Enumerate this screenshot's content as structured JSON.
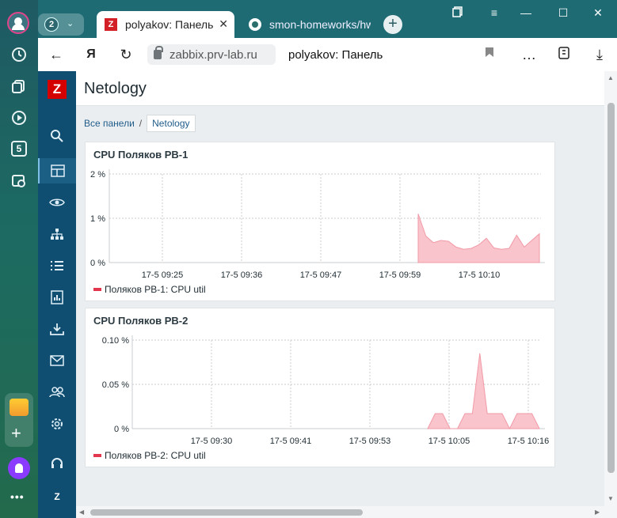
{
  "browser": {
    "tab_count": "2",
    "tabs": [
      {
        "title": "polyakov: Панель",
        "active": true
      },
      {
        "title": "smon-homeworks/hw",
        "active": false
      }
    ],
    "url": "zabbix.prv-lab.ru",
    "page_title": "polyakov: Панель"
  },
  "app": {
    "dashboard_title": "Netology",
    "breadcrumb": {
      "all": "Все панели",
      "separator": "/",
      "current": "Netology"
    }
  },
  "widgets": [
    {
      "title": "CPU Поляков РВ-1",
      "legend": "Поляков РВ-1: CPU util"
    },
    {
      "title": "CPU Поляков РВ-2",
      "legend": "Поляков РВ-2: CPU util"
    }
  ],
  "colors": {
    "series": "#e3374f",
    "fill": "#f9c4cb",
    "accent": "#d40000",
    "sidebar": "#0f4e70"
  },
  "chart_data": [
    {
      "type": "area",
      "title": "CPU Поляков РВ-1",
      "ylabel": "",
      "y_ticks": [
        "0 %",
        "1 %",
        "2 %"
      ],
      "ylim": [
        0,
        2
      ],
      "x_ticks": [
        "17-5 09:25",
        "17-5 09:36",
        "17-5 09:47",
        "17-5 09:59",
        "17-5 10:10"
      ],
      "series": [
        {
          "name": "Поляков РВ-1: CPU util",
          "x": [
            "10:01",
            "10:02",
            "10:03",
            "10:04",
            "10:05",
            "10:06",
            "10:07",
            "10:08",
            "10:09",
            "10:10",
            "10:11",
            "10:12",
            "10:13",
            "10:14",
            "10:15",
            "10:16",
            "10:17"
          ],
          "values": [
            1.1,
            0.6,
            0.45,
            0.5,
            0.48,
            0.35,
            0.3,
            0.32,
            0.4,
            0.55,
            0.33,
            0.3,
            0.32,
            0.62,
            0.35,
            0.5,
            0.65
          ]
        }
      ]
    },
    {
      "type": "area",
      "title": "CPU Поляков РВ-2",
      "ylabel": "",
      "y_ticks": [
        "0 %",
        "0.05 %",
        "0.10 %"
      ],
      "ylim": [
        0,
        0.1
      ],
      "x_ticks": [
        "17-5 09:30",
        "17-5 09:41",
        "17-5 09:53",
        "17-5 10:05",
        "17-5 10:16"
      ],
      "series": [
        {
          "name": "Поляков РВ-2: CPU util",
          "x": [
            "10:03",
            "10:04",
            "10:05",
            "10:06",
            "10:07",
            "10:08",
            "10:09",
            "10:10",
            "10:11",
            "10:12",
            "10:13",
            "10:14",
            "10:15",
            "10:16",
            "10:17",
            "10:18"
          ],
          "values": [
            0,
            0.017,
            0.017,
            0,
            0,
            0.017,
            0.017,
            0.085,
            0.017,
            0.017,
            0.017,
            0,
            0.017,
            0.017,
            0.017,
            0
          ]
        }
      ]
    }
  ]
}
